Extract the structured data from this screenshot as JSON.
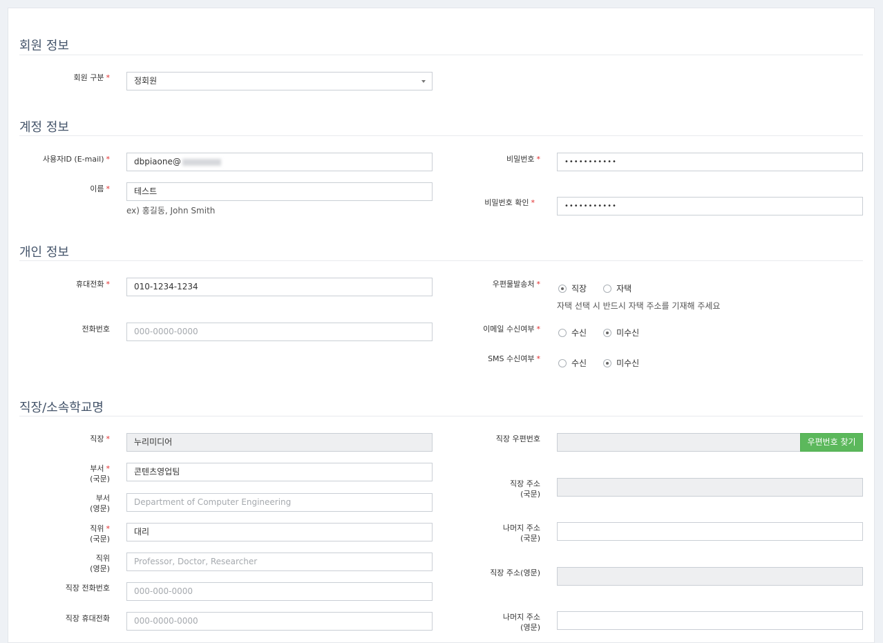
{
  "sections": {
    "member": "회원 정보",
    "account": "계정 정보",
    "personal": "개인 정보",
    "workplace": "직장/소속학교명"
  },
  "member": {
    "type_label": "회원 구분",
    "type_value": "정회원"
  },
  "account": {
    "userid_label": "사용자ID (E-mail)",
    "userid_value": "dbpiaone@",
    "name_label": "이름",
    "name_value": "테스트",
    "name_hint": "ex) 홍길동, John Smith",
    "password_label": "비밀번호",
    "password_value": "•••••••••••",
    "password_confirm_label": "비밀번호 확인",
    "password_confirm_value": "•••••••••••"
  },
  "personal": {
    "mobile_label": "휴대전화",
    "mobile_value": "010-1234-1234",
    "phone_label": "전화번호",
    "phone_placeholder": "000-0000-0000",
    "mail_dest_label": "우편물발송처",
    "mail_dest_options": [
      "직장",
      "자택"
    ],
    "mail_dest_selected": "직장",
    "mail_dest_hint": "자택 선택 시 반드시 자택 주소를 기재해 주세요",
    "email_consent_label": "이메일 수신여부",
    "email_consent_options": [
      "수신",
      "미수신"
    ],
    "email_consent_selected": "미수신",
    "sms_consent_label": "SMS 수신여부",
    "sms_consent_options": [
      "수신",
      "미수신"
    ],
    "sms_consent_selected": "미수신"
  },
  "workplace": {
    "company_label": "직장",
    "company_value": "누리미디어",
    "dept_ko_label_1": "부서",
    "dept_ko_label_2": "(국문)",
    "dept_ko_value": "콘텐츠영업팀",
    "dept_en_label_1": "부서",
    "dept_en_label_2": "(영문)",
    "dept_en_placeholder": "Department of Computer Engineering",
    "position_ko_label_1": "직위",
    "position_ko_label_2": "(국문)",
    "position_ko_value": "대리",
    "position_en_label_1": "직위",
    "position_en_label_2": "(영문)",
    "position_en_placeholder": "Professor, Doctor, Researcher",
    "work_phone_label": "직장 전화번호",
    "work_phone_placeholder": "000-000-0000",
    "work_mobile_label": "직장 휴대전화",
    "work_mobile_placeholder": "000-0000-0000",
    "zip_label": "직장 우편번호",
    "zip_button": "우편번호 찾기",
    "addr_ko_label_1": "직장 주소",
    "addr_ko_label_2": "(국문)",
    "addr_rest_ko_label_1": "나머지 주소",
    "addr_rest_ko_label_2": "(국문)",
    "addr_en_label": "직장 주소(영문)",
    "addr_rest_en_label_1": "나머지 주소",
    "addr_rest_en_label_2": "(영문)"
  },
  "required_mark": "*",
  "colors": {
    "accent_green": "#5cb85c",
    "required_red": "#e02b2b",
    "section_title": "#44546a"
  }
}
